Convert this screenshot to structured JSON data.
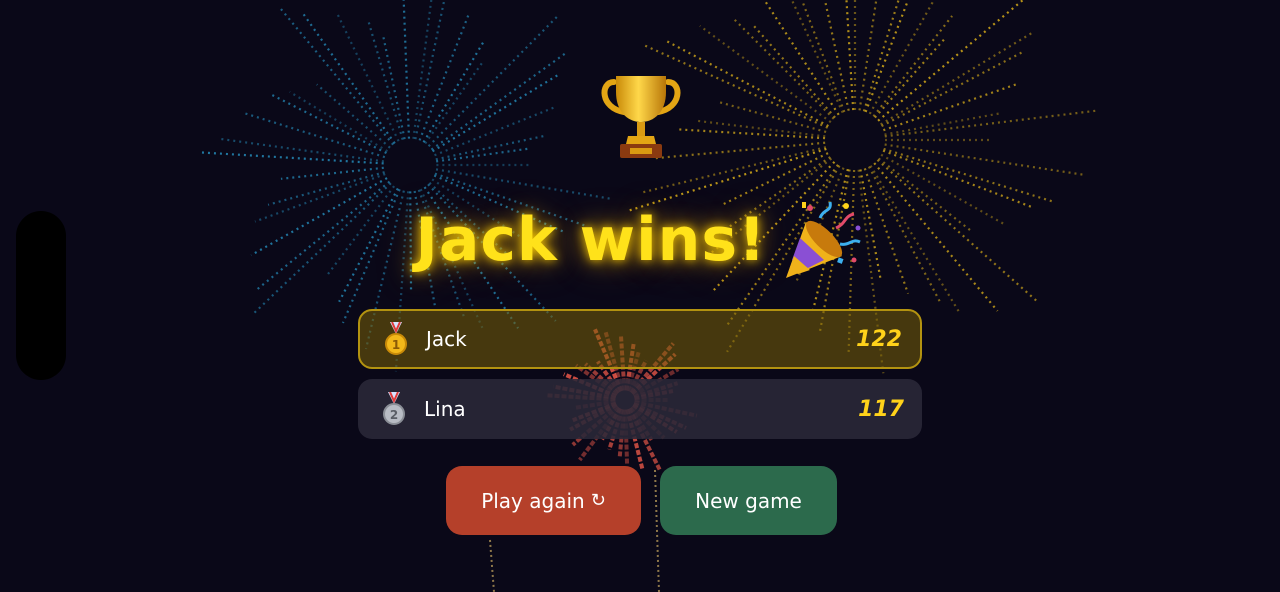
{
  "theme": {
    "background": "#0a0818",
    "title_color": "#ffe21a",
    "first_row_border": "#b39310",
    "score_color": "#ffd21a",
    "play_again_color": "#b5402a",
    "new_game_color": "#2c6a4c"
  },
  "icons": {
    "trophy": "trophy-icon",
    "party_popper": "party-popper-icon",
    "gold_medal": "gold-medal-icon",
    "silver_medal": "silver-medal-icon",
    "refresh": "refresh-icon"
  },
  "result": {
    "title": "Jack wins!"
  },
  "leaderboard": [
    {
      "rank": "1",
      "name": "Jack",
      "score": "122",
      "medal": "gold-medal-icon"
    },
    {
      "rank": "2",
      "name": "Lina",
      "score": "117",
      "medal": "silver-medal-icon"
    }
  ],
  "buttons": {
    "play_again": "Play again",
    "refresh_glyph": "↻",
    "new_game": "New game"
  }
}
